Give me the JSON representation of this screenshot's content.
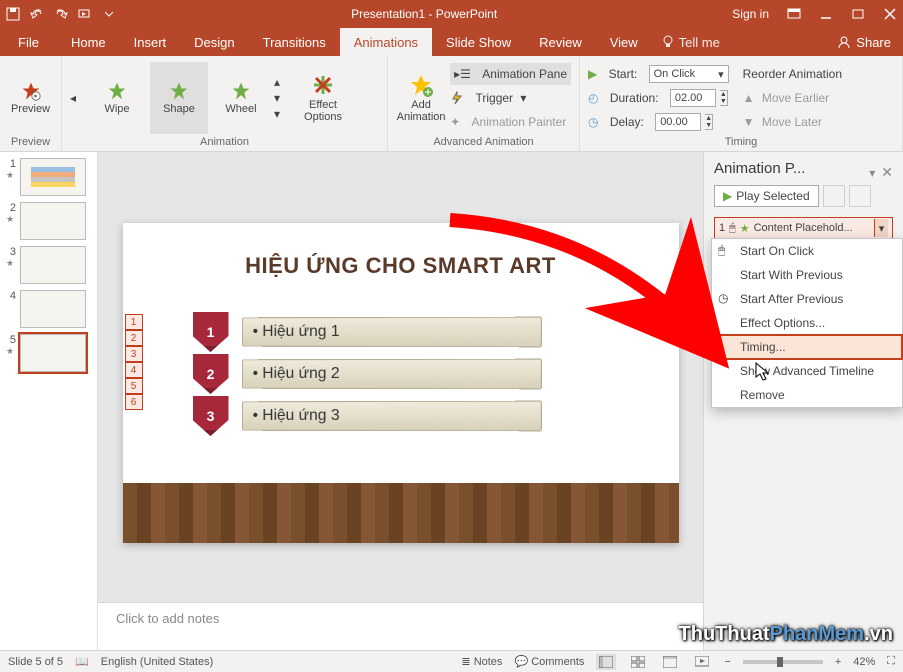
{
  "title": "Presentation1 - PowerPoint",
  "signin": "Sign in",
  "tabs": {
    "file": "File",
    "home": "Home",
    "insert": "Insert",
    "design": "Design",
    "transitions": "Transitions",
    "animations": "Animations",
    "slideshow": "Slide Show",
    "review": "Review",
    "view": "View",
    "tellme": "Tell me",
    "share": "Share"
  },
  "ribbon": {
    "preview": "Preview",
    "preview_group": "Preview",
    "gallery": {
      "wipe": "Wipe",
      "shape": "Shape",
      "wheel": "Wheel"
    },
    "effect_options": "Effect\nOptions",
    "animation_group": "Animation",
    "add_animation": "Add\nAnimation",
    "anim_pane": "Animation Pane",
    "trigger": "Trigger",
    "painter": "Animation Painter",
    "adv_group": "Advanced Animation",
    "start": "Start:",
    "start_val": "On Click",
    "duration": "Duration:",
    "duration_val": "02.00",
    "delay": "Delay:",
    "delay_val": "00.00",
    "reorder": "Reorder Animation",
    "earlier": "Move Earlier",
    "later": "Move Later",
    "timing_group": "Timing"
  },
  "thumbs": [
    1,
    2,
    3,
    4,
    5
  ],
  "thumb_selected": 5,
  "slide": {
    "title": "HIỆU ỨNG CHO SMART ART",
    "tags": [
      1,
      2,
      3,
      4,
      5,
      6
    ],
    "rows": [
      {
        "n": "1",
        "t": "Hiệu ứng 1"
      },
      {
        "n": "2",
        "t": "Hiệu ứng 2"
      },
      {
        "n": "3",
        "t": "Hiệu ứng 3"
      }
    ]
  },
  "notes_placeholder": "Click to add notes",
  "apane": {
    "title": "Animation P...",
    "play": "Play Selected",
    "entry_num": "1",
    "entry_label": "Content Placehold..."
  },
  "ctx": {
    "start_click": "Start On Click",
    "start_with": "Start With Previous",
    "start_after": "Start After Previous",
    "effect": "Effect Options...",
    "timing": "Timing...",
    "adv": "Show Advanced Timeline",
    "remove": "Remove"
  },
  "status": {
    "slide": "Slide 5 of 5",
    "lang": "English (United States)",
    "notes": "Notes",
    "comments": "Comments",
    "zoom": "42%"
  },
  "watermark": {
    "a": "ThuThuat",
    "b": "PhanMem",
    "c": ".vn"
  }
}
